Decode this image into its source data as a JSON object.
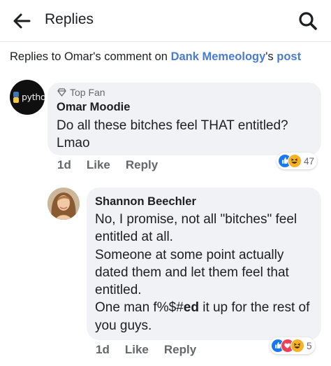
{
  "header": {
    "title": "Replies",
    "back_icon": "arrow-left-icon",
    "search_icon": "search-icon"
  },
  "context": {
    "prefix": "Replies to Omar's comment on ",
    "page_name": "Dank Memeology",
    "possessive": "'s ",
    "post_link": "post"
  },
  "comment": {
    "avatar_label": "python",
    "badge": "Top Fan",
    "author": "Omar Moodie",
    "text": "Do all these bitches feel THAT entitled? Lmao",
    "time": "1d",
    "like_label": "Like",
    "reply_label": "Reply",
    "reactions": [
      "like",
      "haha"
    ],
    "reaction_count": "47"
  },
  "reply": {
    "author": "Shannon Beechler",
    "text_before_bold": "No, I promise, not all \"bitches\" feel entitled at all.\nSomeone at some point actually dated them and let them feel that entitled.\nOne man f%$#",
    "text_bold": "ed",
    "text_after_bold": " it up for the rest of you guys.",
    "time": "1d",
    "like_label": "Like",
    "reply_label": "Reply",
    "reactions": [
      "like",
      "love",
      "haha"
    ],
    "reaction_count": "5"
  },
  "colors": {
    "link": "#4a7bd1",
    "bubble": "#f0f2f5",
    "meta": "#65676b",
    "like_blue": "#1877f2",
    "love_red": "#f33e58",
    "haha_yellow": "#f7b125"
  }
}
